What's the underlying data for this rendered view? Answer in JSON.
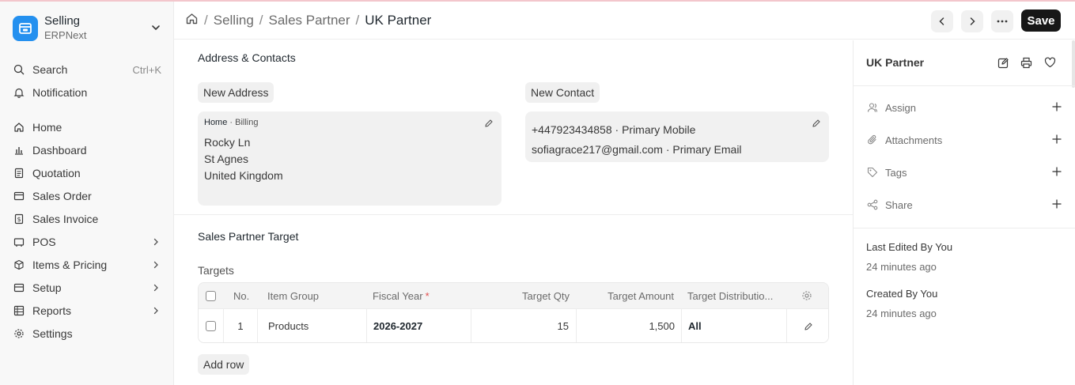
{
  "app": {
    "name": "Selling",
    "sub": "ERPNext"
  },
  "sidebar": {
    "search": {
      "label": "Search",
      "shortcut": "Ctrl+K"
    },
    "notification": "Notification",
    "items": [
      {
        "label": "Home",
        "icon": "home-icon",
        "has_children": false
      },
      {
        "label": "Dashboard",
        "icon": "dashboard-icon",
        "has_children": false
      },
      {
        "label": "Quotation",
        "icon": "document-icon",
        "has_children": false
      },
      {
        "label": "Sales Order",
        "icon": "order-icon",
        "has_children": false
      },
      {
        "label": "Sales Invoice",
        "icon": "invoice-icon",
        "has_children": false
      },
      {
        "label": "POS",
        "icon": "pos-icon",
        "has_children": true
      },
      {
        "label": "Items & Pricing",
        "icon": "box-icon",
        "has_children": true
      },
      {
        "label": "Setup",
        "icon": "setup-icon",
        "has_children": true
      },
      {
        "label": "Reports",
        "icon": "table-icon",
        "has_children": true
      },
      {
        "label": "Settings",
        "icon": "gear-icon",
        "has_children": false
      }
    ]
  },
  "breadcrumb": {
    "items": [
      "Selling",
      "Sales Partner"
    ],
    "current": "UK Partner",
    "separator": "/"
  },
  "toolbar": {
    "save_label": "Save"
  },
  "address_contacts": {
    "title": "Address & Contacts",
    "new_address_label": "New Address",
    "new_contact_label": "New Contact",
    "address": {
      "title": "Home",
      "type": "Billing",
      "lines": [
        "Rocky Ln",
        "St Agnes",
        "United Kingdom"
      ]
    },
    "contact": {
      "phone": "+447923434858",
      "phone_label": "Primary Mobile",
      "email": "sofiagrace217@gmail.com",
      "email_label": "Primary Email"
    }
  },
  "target_section": {
    "title": "Sales Partner Target",
    "table_label": "Targets",
    "columns": {
      "no": "No.",
      "item_group": "Item Group",
      "fiscal_year": "Fiscal Year",
      "required_mark": "*",
      "target_qty": "Target Qty",
      "target_amount": "Target Amount",
      "distribution": "Target Distributio..."
    },
    "rows": [
      {
        "no": "1",
        "item_group": "Products",
        "fiscal_year": "2026-2027",
        "target_qty": "15",
        "target_amount": "1,500",
        "distribution": "All"
      }
    ],
    "add_row_label": "Add row"
  },
  "sidebar_right": {
    "title": "UK Partner",
    "actions": [
      {
        "label": "Assign",
        "icon": "user-icon"
      },
      {
        "label": "Attachments",
        "icon": "paperclip-icon"
      },
      {
        "label": "Tags",
        "icon": "tag-icon"
      },
      {
        "label": "Share",
        "icon": "share-icon"
      }
    ],
    "last_edited": "Last Edited By You",
    "last_edited_time": "24 minutes ago",
    "created": "Created By You",
    "created_time": "24 minutes ago"
  },
  "colors": {
    "accent": "#2490ef",
    "primary_button": "#171717",
    "required": "#e24c4c"
  }
}
